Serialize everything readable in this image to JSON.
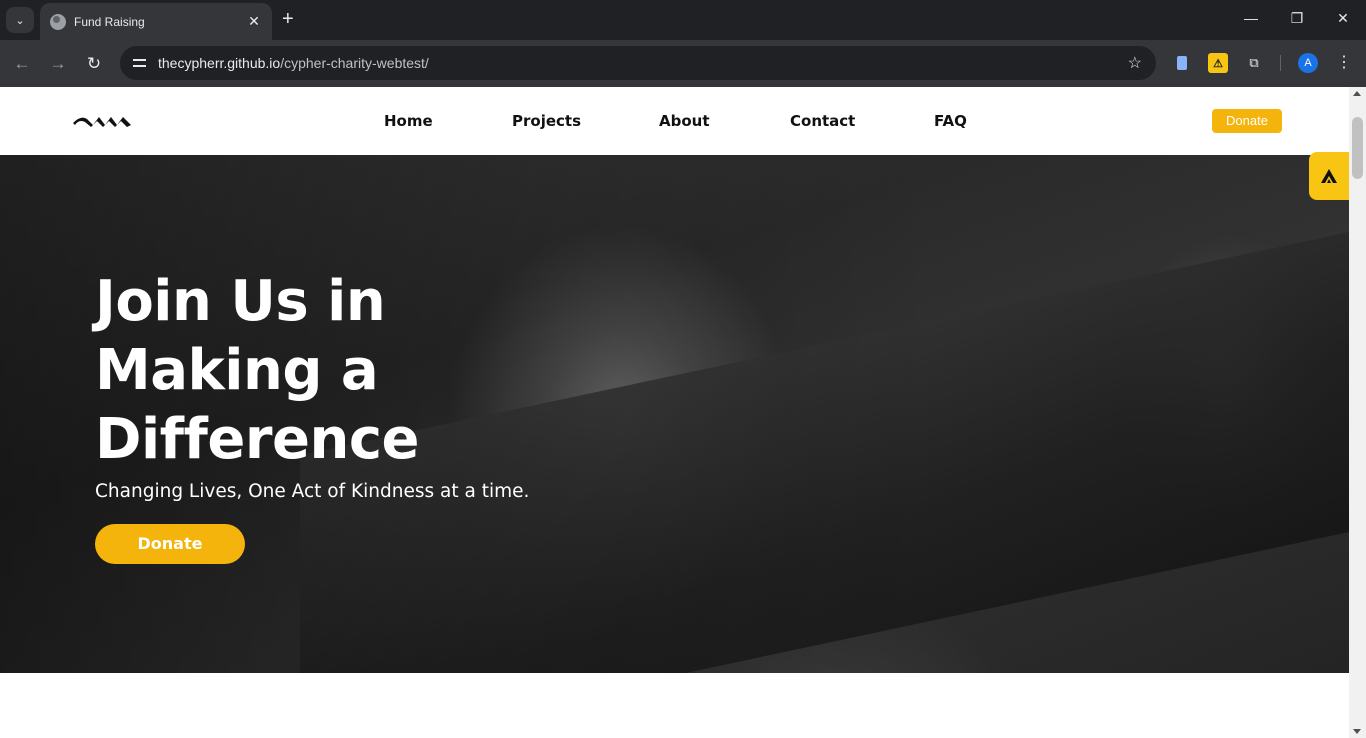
{
  "browser": {
    "tab_title": "Fund Raising",
    "tab_close": "✕",
    "new_tab": "+",
    "url_host": "thecypherr.github.io",
    "url_path": "/cypher-charity-webtest/",
    "profile_initial": "A",
    "icons": [
      "tab-search-icon",
      "globe-icon",
      "close-icon",
      "plus-icon",
      "back-icon",
      "forward-icon",
      "reload-icon",
      "site-info-icon",
      "star-icon",
      "extension-doc-icon",
      "extension-warning-icon",
      "puzzle-icon",
      "menu-dots-icon"
    ]
  },
  "site": {
    "nav": {
      "items": [
        {
          "label": "Home"
        },
        {
          "label": "Projects"
        },
        {
          "label": "About"
        },
        {
          "label": "Contact"
        },
        {
          "label": "FAQ"
        }
      ],
      "donate_label": "Donate"
    },
    "hero": {
      "title_line1": "Join Us in",
      "title_line2": "Making a",
      "title_line3": "Difference",
      "subtitle": "Changing Lives, One Act of Kindness at a time.",
      "cta_label": "Donate"
    }
  },
  "colors": {
    "accent": "#f5b40c",
    "badge": "#f9c513",
    "chrome_bg": "#202124",
    "chrome_toolbar": "#35363a"
  }
}
